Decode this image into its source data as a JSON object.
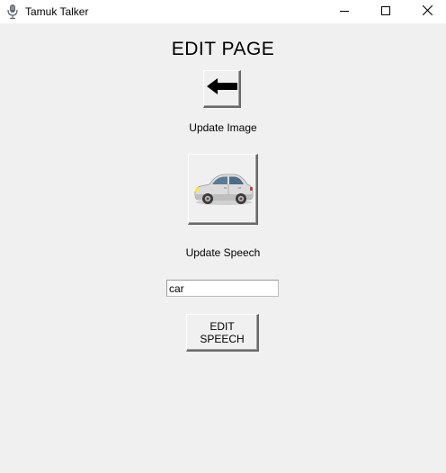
{
  "window": {
    "title": "Tamuk Talker",
    "app_icon": "microphone-icon",
    "controls": {
      "minimize_icon": "minimize-icon",
      "maximize_icon": "maximize-icon",
      "close_icon": "close-icon"
    }
  },
  "page": {
    "title": "EDIT PAGE",
    "back_icon": "left-arrow-icon",
    "update_image_label": "Update Image",
    "image_icon": "car-image",
    "update_speech_label": "Update Speech",
    "speech_input_value": "car",
    "edit_speech_label": "EDIT SPEECH"
  }
}
